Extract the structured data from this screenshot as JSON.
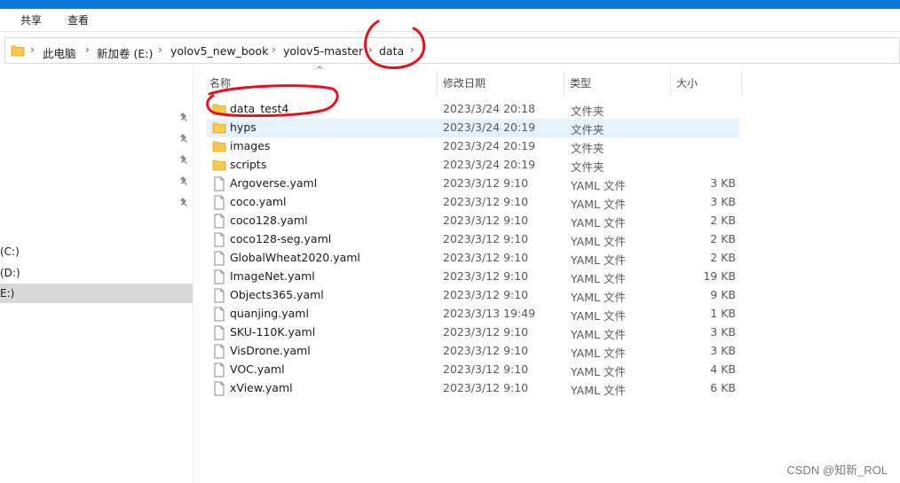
{
  "ribbon": {
    "tabs": [
      "共享",
      "查看"
    ]
  },
  "address": {
    "crumbs": [
      "此电脑",
      "新加卷 (E:)",
      "yolov5_new_book",
      "yolov5-master",
      "data"
    ]
  },
  "columns": {
    "name": "名称",
    "date": "修改日期",
    "type": "类型",
    "size": "大小"
  },
  "nav": {
    "drives": [
      "(C:)",
      "(D:)",
      "E:)"
    ],
    "selected_drive_index": 2
  },
  "files": [
    {
      "name": "data_test4",
      "date": "2023/3/24 20:18",
      "type": "文件夹",
      "size": "",
      "kind": "folder-icon"
    },
    {
      "name": "hyps",
      "date": "2023/3/24 20:19",
      "type": "文件夹",
      "size": "",
      "kind": "folder-icon"
    },
    {
      "name": "images",
      "date": "2023/3/24 20:19",
      "type": "文件夹",
      "size": "",
      "kind": "folder-icon"
    },
    {
      "name": "scripts",
      "date": "2023/3/24 20:19",
      "type": "文件夹",
      "size": "",
      "kind": "folder-icon"
    },
    {
      "name": "Argoverse.yaml",
      "date": "2023/3/12 9:10",
      "type": "YAML 文件",
      "size": "3 KB",
      "kind": "file-icon"
    },
    {
      "name": "coco.yaml",
      "date": "2023/3/12 9:10",
      "type": "YAML 文件",
      "size": "3 KB",
      "kind": "file-icon"
    },
    {
      "name": "coco128.yaml",
      "date": "2023/3/12 9:10",
      "type": "YAML 文件",
      "size": "2 KB",
      "kind": "file-icon"
    },
    {
      "name": "coco128-seg.yaml",
      "date": "2023/3/12 9:10",
      "type": "YAML 文件",
      "size": "2 KB",
      "kind": "file-icon"
    },
    {
      "name": "GlobalWheat2020.yaml",
      "date": "2023/3/12 9:10",
      "type": "YAML 文件",
      "size": "2 KB",
      "kind": "file-icon"
    },
    {
      "name": "ImageNet.yaml",
      "date": "2023/3/12 9:10",
      "type": "YAML 文件",
      "size": "19 KB",
      "kind": "file-icon"
    },
    {
      "name": "Objects365.yaml",
      "date": "2023/3/12 9:10",
      "type": "YAML 文件",
      "size": "9 KB",
      "kind": "file-icon"
    },
    {
      "name": "quanjing.yaml",
      "date": "2023/3/13 19:49",
      "type": "YAML 文件",
      "size": "1 KB",
      "kind": "file-icon"
    },
    {
      "name": "SKU-110K.yaml",
      "date": "2023/3/12 9:10",
      "type": "YAML 文件",
      "size": "3 KB",
      "kind": "file-icon"
    },
    {
      "name": "VisDrone.yaml",
      "date": "2023/3/12 9:10",
      "type": "YAML 文件",
      "size": "3 KB",
      "kind": "file-icon"
    },
    {
      "name": "VOC.yaml",
      "date": "2023/3/12 9:10",
      "type": "YAML 文件",
      "size": "4 KB",
      "kind": "file-icon"
    },
    {
      "name": "xView.yaml",
      "date": "2023/3/12 9:10",
      "type": "YAML 文件",
      "size": "6 KB",
      "kind": "file-icon"
    }
  ],
  "hover_row_index": 1,
  "watermark": "CSDN @知新_ROL",
  "colors": {
    "titlebar": "#0a78d7",
    "hover": "#e5f3ff",
    "selected": "#d9d9d9",
    "folder": "#f8c94a",
    "annotation": "#e0141e"
  }
}
